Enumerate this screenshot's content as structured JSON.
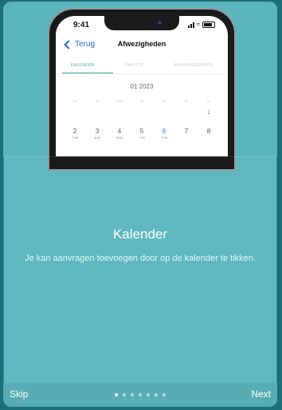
{
  "phone": {
    "status_time": "9:41",
    "back_label": "Terug",
    "nav_title": "Afwezigheden",
    "tabs": [
      {
        "label": "KALENDER",
        "active": true
      },
      {
        "label": "SALDO'S",
        "active": false
      },
      {
        "label": "AANVRAGEN/INFO",
        "active": false
      }
    ],
    "month_label": "01 2023",
    "weekdays": [
      "ma",
      "di",
      "woe",
      "do",
      "vrij",
      "za",
      "zo"
    ],
    "row1_day": "1",
    "row2": [
      {
        "day": "2",
        "hours": "7:50"
      },
      {
        "day": "3",
        "hours": "8:00"
      },
      {
        "day": "4",
        "hours": "8:00"
      },
      {
        "day": "5",
        "hours": "7:50"
      },
      {
        "day": "6",
        "hours": "7:50"
      },
      {
        "day": "7",
        "hours": ""
      },
      {
        "day": "8",
        "hours": ""
      }
    ]
  },
  "onboarding": {
    "title": "Kalender",
    "description": "Je kan aanvragen toevoegen door op de kalender te tikken."
  },
  "footer": {
    "skip_label": "Skip",
    "next_label": "Next",
    "page_count": 7,
    "active_page": 1
  }
}
